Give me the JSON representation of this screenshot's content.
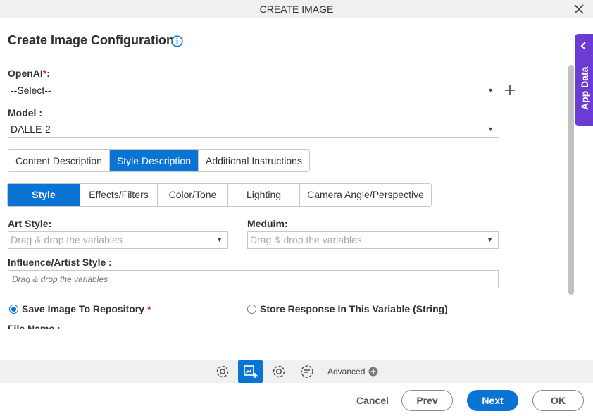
{
  "dialog": {
    "title": "CREATE IMAGE"
  },
  "page": {
    "heading": "Create Image Configuration"
  },
  "openai": {
    "label": "OpenAI",
    "required_mark": "*",
    "colon": ":",
    "value": "--Select--"
  },
  "model": {
    "label": "Model :",
    "value": "DALLE-2"
  },
  "description_tabs": [
    {
      "label": "Content Description",
      "active": false
    },
    {
      "label": "Style Description",
      "active": true
    },
    {
      "label": "Additional Instructions",
      "active": false
    }
  ],
  "style_tabs": [
    {
      "label": "Style",
      "active": true
    },
    {
      "label": "Effects/Filters",
      "active": false
    },
    {
      "label": "Color/Tone",
      "active": false
    },
    {
      "label": "Lighting",
      "active": false
    },
    {
      "label": "Camera Angle/Perspective",
      "active": false
    }
  ],
  "art_style": {
    "label": "Art Style:",
    "placeholder": "Drag & drop the variables"
  },
  "medium": {
    "label": "Meduim:",
    "placeholder": "Drag & drop the variables"
  },
  "influence": {
    "label": "Influence/Artist Style :",
    "placeholder": "Drag & drop the variables"
  },
  "output_options": [
    {
      "label": "Save Image To Repository",
      "required_mark": "*",
      "selected": true
    },
    {
      "label": "Store Response In This Variable (String)",
      "selected": false
    }
  ],
  "cutoff_label": "File Name :",
  "side_panel": {
    "label": "App Data"
  },
  "toolbar": {
    "advanced_label": "Advanced"
  },
  "footer": {
    "cancel": "Cancel",
    "prev": "Prev",
    "next": "Next",
    "ok": "OK"
  },
  "colors": {
    "primary": "#0a74d5",
    "app_data": "#6a3cd4",
    "required": "#d2232a"
  }
}
